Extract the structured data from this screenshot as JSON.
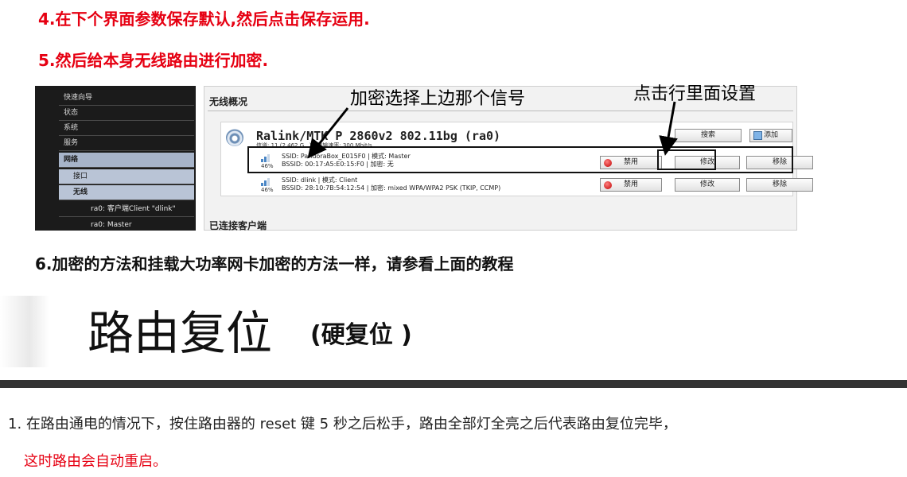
{
  "steps": {
    "step4": "4.在下个界面参数保存默认,然后点击保存运用.",
    "step5": "5.然后给本身无线路由进行加密.",
    "step6": "6.加密的方法和挂载大功率网卡加密的方法一样，请参看上面的教程"
  },
  "screenshot": {
    "sidebar": [
      {
        "label": "快速向导"
      },
      {
        "label": "状态"
      },
      {
        "label": "系统"
      },
      {
        "label": "服务"
      },
      {
        "label": "网络"
      },
      {
        "label": "接口"
      },
      {
        "label": "无线"
      },
      {
        "label": "ra0: 客户端Client \"dlink\""
      },
      {
        "label": "ra0: Master"
      }
    ],
    "panel_title": "无线概况",
    "device": {
      "name": "Ralink/MTK P 2860v2 802.11bg (ra0)",
      "info": "信道: 11 (2.462 G...) | 传输速率: 300 Mbit/s"
    },
    "networks": [
      {
        "signal": "46%",
        "line1": "SSID: PandoraBox_E015F0 | 模式: Master",
        "line2": "BSSID: 00:17:A5:E0:15:F0 | 加密: 无"
      },
      {
        "signal": "46%",
        "line1": "SSID: dlink | 模式: Client",
        "line2": "BSSID: 28:10:7B:54:12:54 | 加密: mixed WPA/WPA2 PSK (TKIP, CCMP)"
      }
    ],
    "buttons": {
      "scan": "搜索",
      "add": "添加",
      "disable": "禁用",
      "edit": "修改",
      "remove": "移除"
    },
    "connected_title": "已连接客户端"
  },
  "annotations": {
    "left": "加密选择上边那个信号",
    "right": "点击行里面设置"
  },
  "reset": {
    "title": "路由复位",
    "subtitle": "(硬复位 )",
    "desc": "1. 在路由通电的情况下，按住路由器的 reset 键 5 秒之后松手，路由全部灯全亮之后代表路由复位完毕，",
    "note": "这时路由会自动重启。"
  },
  "colors": {
    "red": "#e60012",
    "sidebar_bg": "#1b1b1b",
    "sidebar_active": "#a7b4c9"
  }
}
